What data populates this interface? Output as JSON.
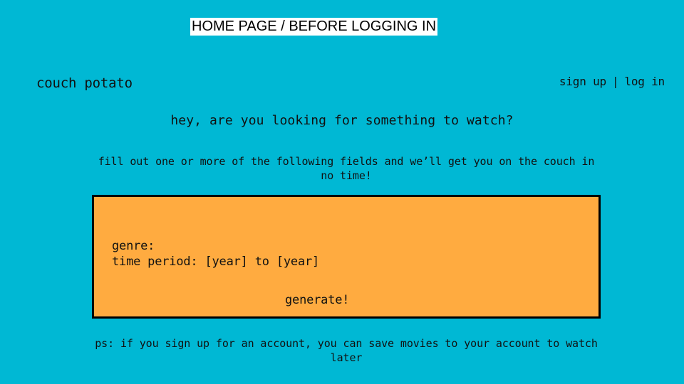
{
  "page_label": "HOME PAGE / BEFORE LOGGING IN",
  "header": {
    "brand": "couch potato",
    "sign_up": "sign up",
    "separator": "|",
    "log_in": "log in"
  },
  "hero": {
    "headline": "hey, are you looking for something to watch?",
    "instructions": "fill out one or more of the following fields and we’ll get you on the couch in no time!"
  },
  "form": {
    "genre_label": "genre:",
    "period_label": "time period:",
    "year_from": "[year]",
    "to_word": "to",
    "year_to": "[year]",
    "generate_label": "generate!"
  },
  "footnote": "ps: if you sign up for an account, you can save movies to your account to watch later",
  "colors": {
    "background": "#00b8d4",
    "panel": "#ffab40",
    "border": "#000000"
  }
}
